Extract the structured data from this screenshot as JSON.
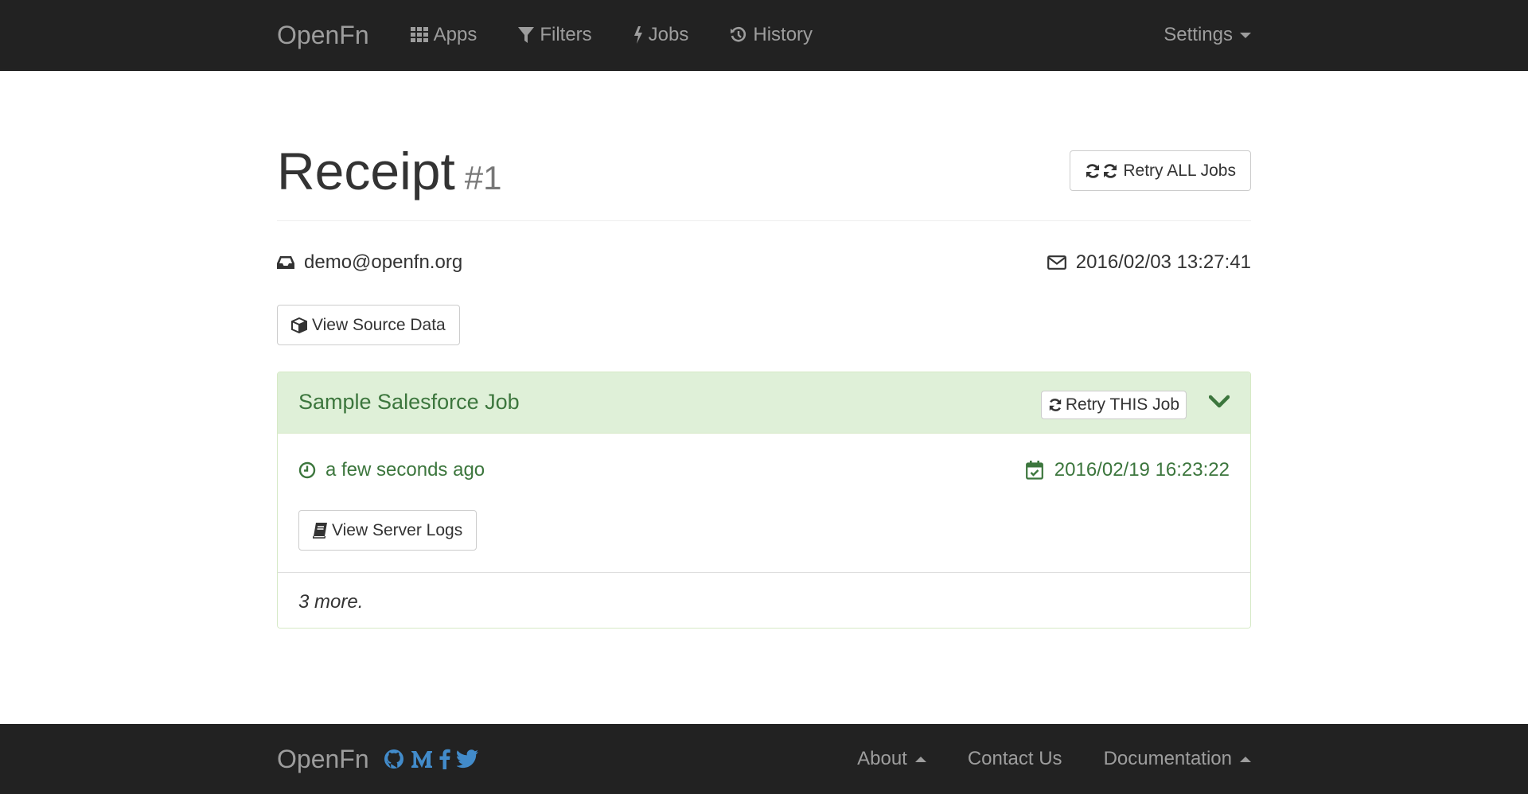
{
  "navbar": {
    "brand": "OpenFn",
    "items": [
      {
        "label": "Apps",
        "icon": "grid-icon"
      },
      {
        "label": "Filters",
        "icon": "filter-icon"
      },
      {
        "label": "Jobs",
        "icon": "bolt-icon"
      },
      {
        "label": "History",
        "icon": "history-icon"
      }
    ],
    "settings_label": "Settings"
  },
  "receipt": {
    "title": "Receipt",
    "number": "#1",
    "retry_all_label": "Retry ALL Jobs",
    "sender": "demo@openfn.org",
    "received_at": "2016/02/03 13:27:41",
    "view_source_label": "View Source Data"
  },
  "job_panel": {
    "title": "Sample Salesforce Job",
    "retry_this_label": "Retry THIS Job",
    "relative_time": "a few seconds ago",
    "run_at": "2016/02/19 16:23:22",
    "view_logs_label": "View Server Logs",
    "more_text": "3 more."
  },
  "footer": {
    "brand": "OpenFn",
    "social_icons": [
      "github-icon",
      "medium-icon",
      "facebook-icon",
      "twitter-icon"
    ],
    "links": [
      {
        "label": "About",
        "dropdown": true
      },
      {
        "label": "Contact Us",
        "dropdown": false
      },
      {
        "label": "Documentation",
        "dropdown": true
      }
    ]
  },
  "colors": {
    "navbar_bg": "#222222",
    "panel_success_bg": "#dff0d8",
    "success_text": "#3c763d",
    "social_blue": "#428bca"
  }
}
